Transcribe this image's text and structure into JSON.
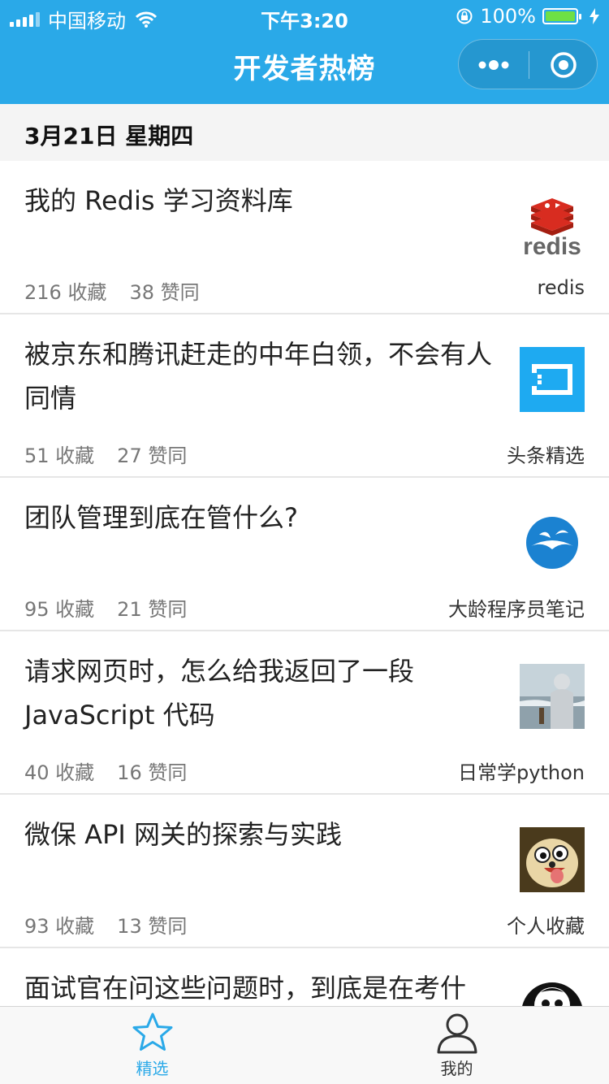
{
  "status_bar": {
    "carrier": "中国移动",
    "time": "下午3:20",
    "battery": "100%",
    "battery_level": 1.0
  },
  "nav": {
    "title": "开发者热榜",
    "more_icon": "more-dots-icon",
    "close_icon": "target-circle-icon"
  },
  "date": "3月21日 星期四",
  "items": [
    {
      "title": "我的 Redis 学习资料库",
      "favorites": "216 收藏",
      "likes": "38 赞同",
      "source": "redis",
      "thumb": "redis-logo"
    },
    {
      "title": "被京东和腾讯赶走的中年白领，不会有人同情",
      "favorites": "51 收藏",
      "likes": "27 赞同",
      "source": "头条精选",
      "thumb": "square-logo"
    },
    {
      "title": "团队管理到底在管什么?",
      "favorites": "95 收藏",
      "likes": "21 赞同",
      "source": "大龄程序员笔记",
      "thumb": "bird-logo"
    },
    {
      "title": "请求网页时，怎么给我返回了一段 JavaScript 代码",
      "favorites": "40 收藏",
      "likes": "16 赞同",
      "source": "日常学python",
      "thumb": "person-photo"
    },
    {
      "title": "微保 API 网关的探索与实践",
      "favorites": "93 收藏",
      "likes": "13 赞同",
      "source": "个人收藏",
      "thumb": "cartoon-dog"
    },
    {
      "title": "面试官在问这些问题时，到底是在考什",
      "favorites": "",
      "likes": "",
      "source": "",
      "thumb": "monkey-avatar"
    }
  ],
  "tabs": [
    {
      "label": "精选",
      "icon": "star-icon",
      "active": true
    },
    {
      "label": "我的",
      "icon": "user-icon",
      "active": false
    }
  ],
  "colors": {
    "accent": "#2aa9e8",
    "battery": "#6ee046"
  }
}
